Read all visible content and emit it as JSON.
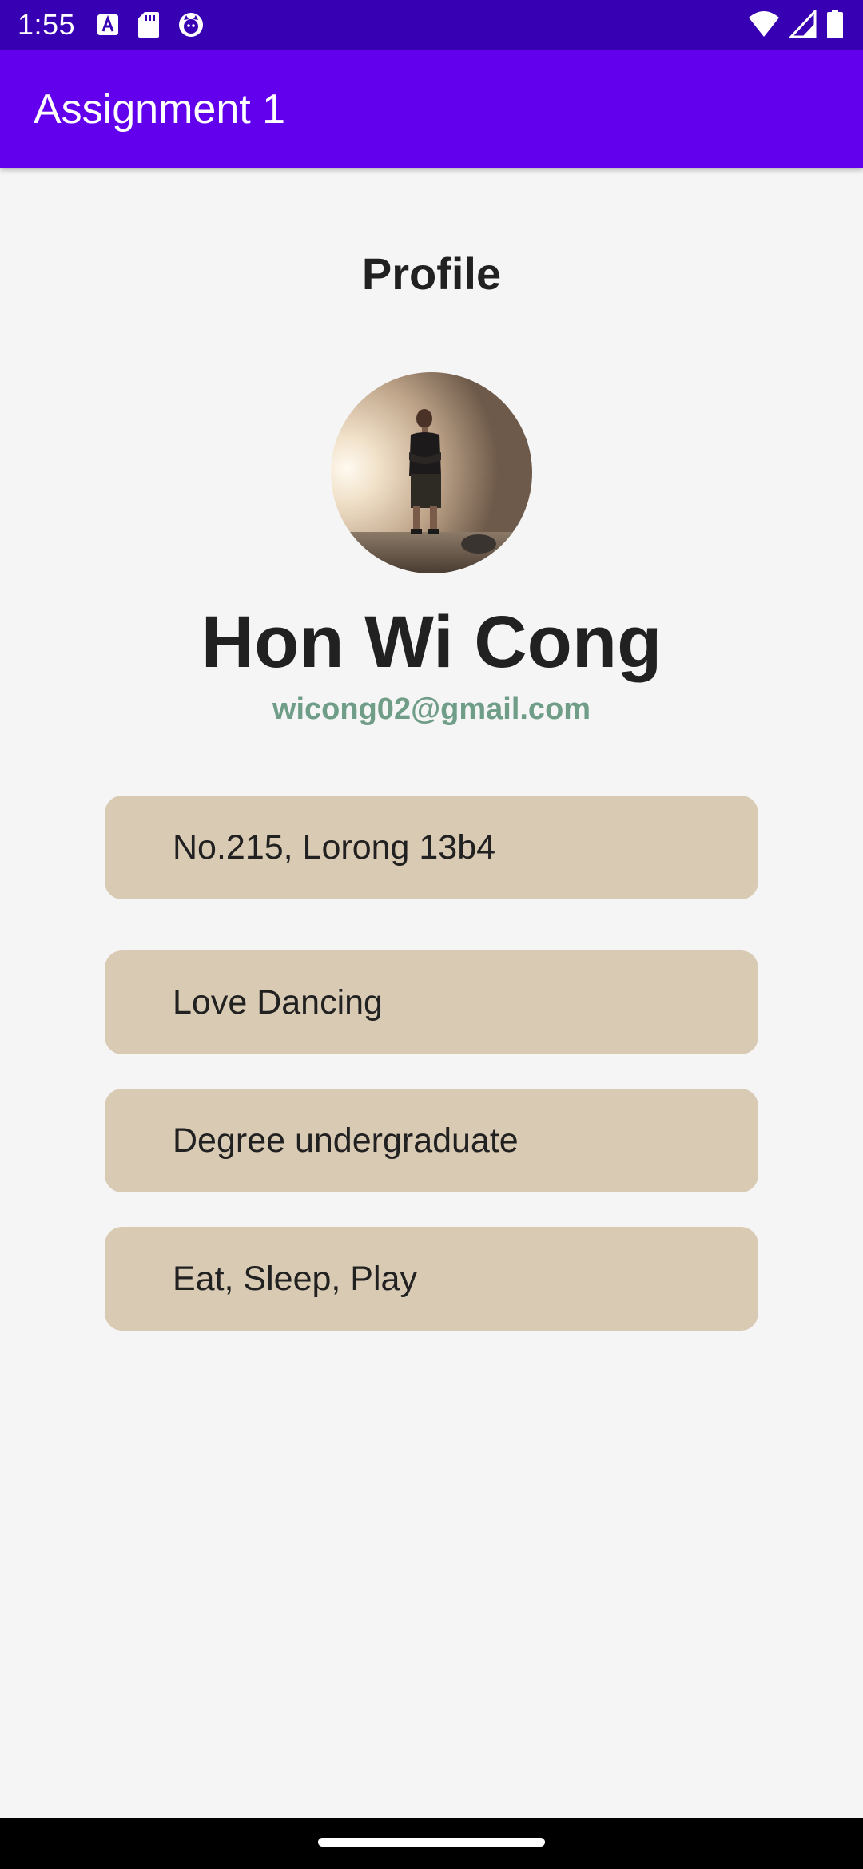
{
  "status_bar": {
    "time": "1:55",
    "left_icons": [
      "font-download-icon",
      "sd-card-icon",
      "cat-face-icon"
    ],
    "right_icons": [
      "wifi-icon",
      "cell-signal-icon",
      "battery-icon"
    ]
  },
  "app_bar": {
    "title": "Assignment 1"
  },
  "profile": {
    "heading": "Profile",
    "name": "Hon Wi Cong",
    "email": "wicong02@gmail.com"
  },
  "info_cards": [
    {
      "text": "No.215, Lorong 13b4"
    },
    {
      "text": "Love Dancing"
    },
    {
      "text": "Degree undergraduate"
    },
    {
      "text": "Eat, Sleep, Play"
    }
  ],
  "colors": {
    "status_bar": "#3700b3",
    "app_bar": "#6200ee",
    "background": "#f5f5f5",
    "card": "#d9cab4",
    "email": "#6f9d87"
  }
}
